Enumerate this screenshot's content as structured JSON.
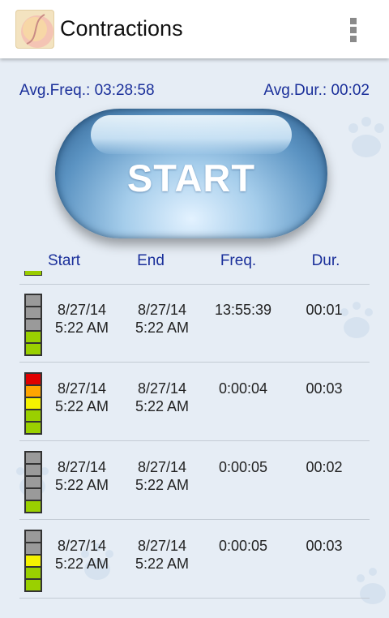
{
  "appbar": {
    "title": "Contractions",
    "menu_icon": "overflow-menu-icon"
  },
  "summary": {
    "avg_freq": "Avg.Freq.: 03:28:58",
    "avg_dur": "Avg.Dur.: 00:02"
  },
  "start_button": {
    "label": "START"
  },
  "columns": {
    "start": "Start",
    "end": "End",
    "freq": "Freq.",
    "dur": "Dur."
  },
  "colors": {
    "gray": "#9a9a9a",
    "yellow": "#f5f200",
    "green": "#9ad000",
    "orange": "#ffa500",
    "red": "#e00000",
    "header_text": "#1a2f9a"
  },
  "rows": [
    {
      "start_date": "8/27/14",
      "start_time": "5:22 AM",
      "end_date": "8/27/14",
      "end_time": "5:22 AM",
      "freq": "13:55:39",
      "dur": "00:01",
      "meter_level": 2
    },
    {
      "start_date": "8/27/14",
      "start_time": "5:22 AM",
      "end_date": "8/27/14",
      "end_time": "5:22 AM",
      "freq": "0:00:04",
      "dur": "00:03",
      "meter_level": 5
    },
    {
      "start_date": "8/27/14",
      "start_time": "5:22 AM",
      "end_date": "8/27/14",
      "end_time": "5:22 AM",
      "freq": "0:00:05",
      "dur": "00:02",
      "meter_level": 1
    },
    {
      "start_date": "8/27/14",
      "start_time": "5:22 AM",
      "end_date": "8/27/14",
      "end_time": "5:22 AM",
      "freq": "0:00:05",
      "dur": "00:03",
      "meter_level": 3
    }
  ]
}
